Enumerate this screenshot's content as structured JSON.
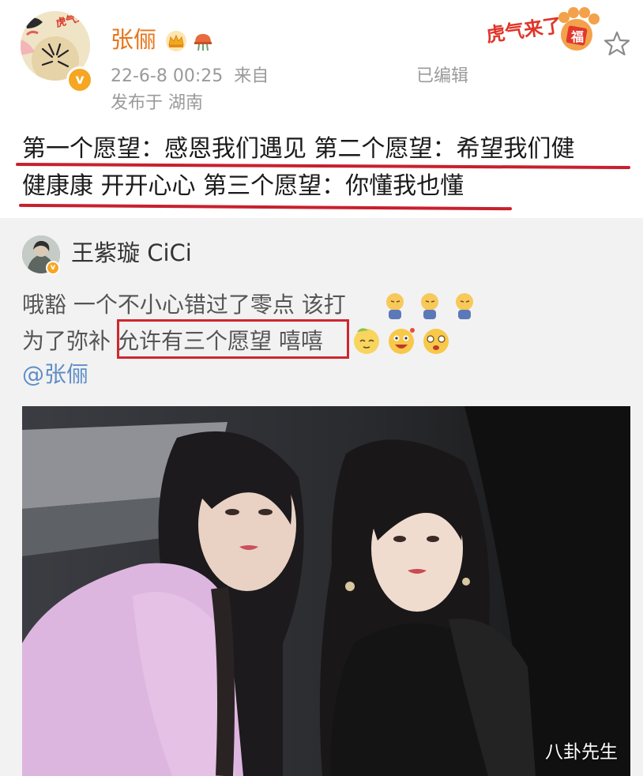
{
  "post": {
    "author": "张俪",
    "time": "22-6-8 00:25",
    "source": "来自",
    "edited_label": "已编辑",
    "location": "发布于 湖南",
    "header_badge_text": "虎气来了",
    "text_line1": "第一个愿望：感恩我们遇见 第二个愿望：希望我们健",
    "text_line2": "健康康 开开心心 第三个愿望：你懂我也懂"
  },
  "repost": {
    "author": "王紫璇 CiCi",
    "line1": "哦豁 一个不小心错过了零点 该打",
    "line2_prefix": "为了弥补",
    "line2_highlight": "允许有三个愿望 嘻嘻",
    "mention": "@张俪",
    "photo_alt": "two women selfie"
  },
  "watermark": "八卦先生",
  "icons": {
    "verified": "verified-v-icon",
    "crown": "crown-badge-icon",
    "helmet": "helmet-badge-icon",
    "star": "star-favorite-icon",
    "tiger_paw": "tiger-paw-fu-icon"
  },
  "colors": {
    "accent_orange": "#e8751a",
    "underline_red": "#c8202e",
    "link_blue": "#5f8ec6",
    "repost_bg": "#f2f2f2"
  }
}
